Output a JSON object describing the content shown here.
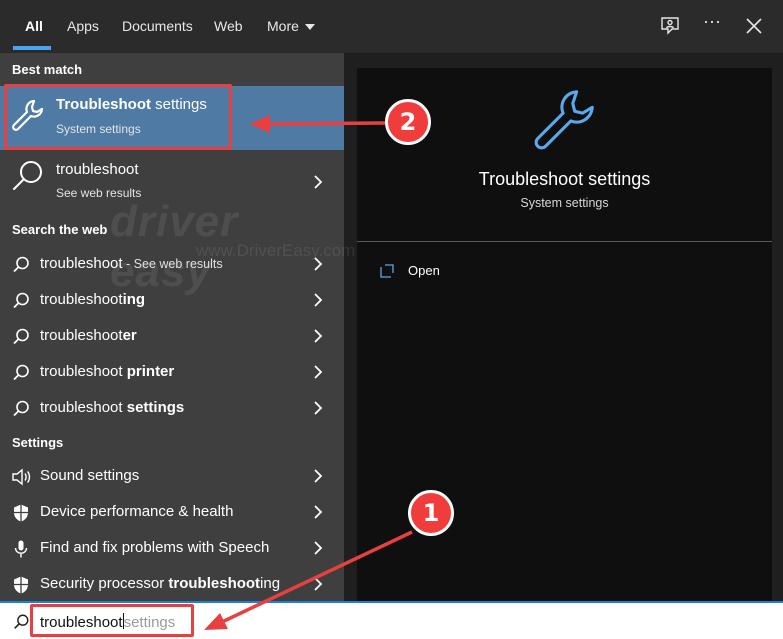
{
  "nav": {
    "tabs": [
      "All",
      "Apps",
      "Documents",
      "Web",
      "More"
    ],
    "active_tab": "All",
    "icons": [
      "feedback-icon",
      "more-options-icon",
      "close-icon"
    ],
    "more_options_glyph": "···"
  },
  "left_pane": {
    "best_match_header": "Best match",
    "best_match": {
      "title": "Troubleshoot settings",
      "title_bold": "Troubleshoot",
      "title_rest": " settings",
      "subtitle": "System settings"
    },
    "web_match": {
      "title": "troubleshoot",
      "subtitle": "See web results"
    },
    "search_web_header": "Search the web",
    "web_items": [
      {
        "prefix": "troubleshoot",
        "bold": "",
        "suffix": " - See web results"
      },
      {
        "prefix": "troubleshoot",
        "bold": "ing",
        "suffix": ""
      },
      {
        "prefix": "troubleshoot",
        "bold": "er",
        "suffix": ""
      },
      {
        "prefix": "troubleshoot ",
        "bold": "printer",
        "suffix": ""
      },
      {
        "prefix": "troubleshoot ",
        "bold": "settings",
        "suffix": ""
      }
    ],
    "settings_header": "Settings",
    "settings_items": [
      {
        "prefix": "Sound settings",
        "bold": "",
        "suffix": "",
        "icon": "speaker-icon"
      },
      {
        "prefix": "Device performance & health",
        "bold": "",
        "suffix": "",
        "icon": "shield-icon"
      },
      {
        "prefix": "Find and fix problems with Speech",
        "bold": "",
        "suffix": "",
        "icon": "microphone-icon"
      },
      {
        "prefix": "Security processor ",
        "bold": "troubleshoot",
        "suffix": "ing",
        "icon": "shield-icon"
      }
    ]
  },
  "right_pane": {
    "title": "Troubleshoot settings",
    "subtitle": "System settings",
    "actions": [
      {
        "label": "Open",
        "icon": "open-icon"
      }
    ]
  },
  "search": {
    "typed": "troubleshoot",
    "completion": "settings"
  },
  "annotations": {
    "badge_1": "1",
    "badge_2": "2",
    "color": "#e84040"
  },
  "watermark": {
    "brand": "driver easy",
    "url": "www.DriverEasy.com"
  },
  "colors": {
    "accent": "#4aa3f2",
    "selection": "#4e7aa3",
    "left_bg": "#3f3f3f",
    "right_bg": "#0f0f0f"
  }
}
